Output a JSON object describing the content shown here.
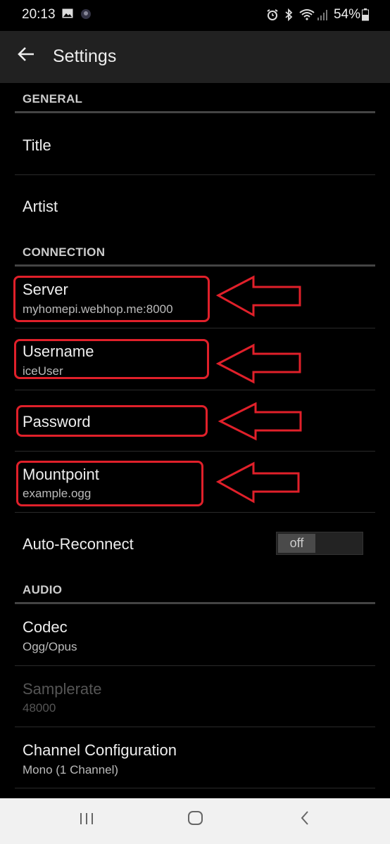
{
  "status_bar": {
    "time": "20:13",
    "left_icons": [
      "image-icon",
      "avatar-notification-icon"
    ],
    "right_icons": [
      "alarm-icon",
      "bluetooth-icon",
      "wifi-icon",
      "signal-icon"
    ],
    "battery": "54%"
  },
  "app_bar": {
    "title": "Settings",
    "back_icon": "arrow-left-icon"
  },
  "sections": {
    "general": "GENERAL",
    "connection": "CONNECTION",
    "audio": "AUDIO"
  },
  "items": {
    "title": {
      "title": "Title"
    },
    "artist": {
      "title": "Artist"
    },
    "server": {
      "title": "Server",
      "summary": "myhomepi.webhop.me:8000"
    },
    "username": {
      "title": "Username",
      "summary": "iceUser"
    },
    "password": {
      "title": "Password"
    },
    "mountpoint": {
      "title": "Mountpoint",
      "summary": "example.ogg"
    },
    "auto_reconnect": {
      "title": "Auto-Reconnect",
      "toggle_label": "off",
      "enabled": false
    },
    "codec": {
      "title": "Codec",
      "summary": "Ogg/Opus"
    },
    "samplerate": {
      "title": "Samplerate",
      "summary": "48000",
      "disabled": true
    },
    "channel": {
      "title": "Channel Configuration",
      "summary": "Mono (1 Channel)"
    }
  },
  "annotation_color": "#e0202a",
  "nav_bar": {
    "recents": "|||",
    "home": "○",
    "back": "‹"
  }
}
